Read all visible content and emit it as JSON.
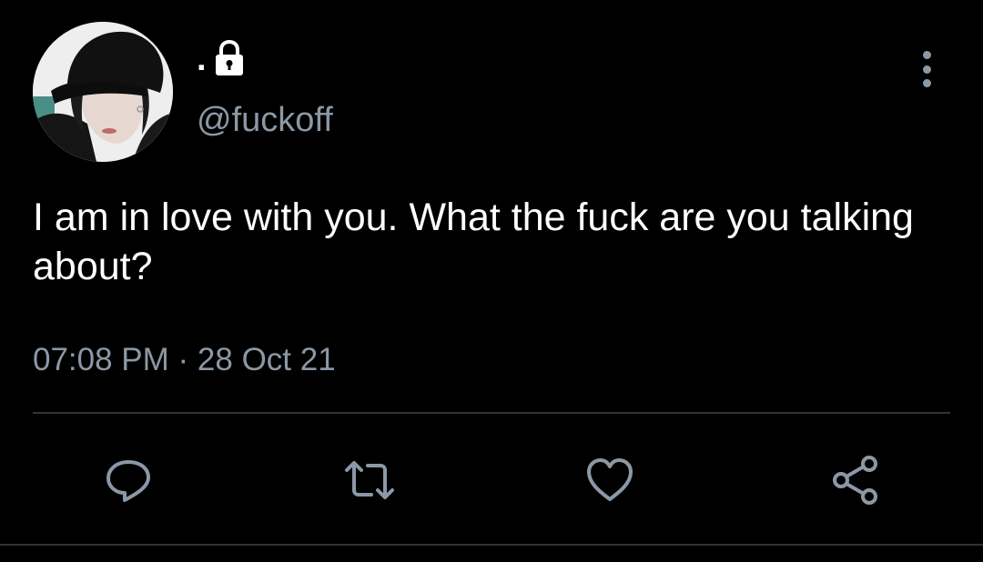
{
  "tweet": {
    "display_name": ".",
    "handle": "@fuckoff",
    "text": "I am in love with you. What the fuck are you talking about?",
    "time": "07:08 PM",
    "separator": " · ",
    "date": "28 Oct 21",
    "protected_icon": "lock-icon",
    "avatar_icon": "profile-photo"
  },
  "actions": [
    {
      "name": "reply",
      "icon": "reply-bubble-icon"
    },
    {
      "name": "retweet",
      "icon": "retweet-icon"
    },
    {
      "name": "like",
      "icon": "heart-icon"
    },
    {
      "name": "share",
      "icon": "share-icon"
    }
  ],
  "colors": {
    "background": "#000000",
    "text": "#ffffff",
    "secondary": "#8b98a5",
    "divider": "#2f3336"
  }
}
